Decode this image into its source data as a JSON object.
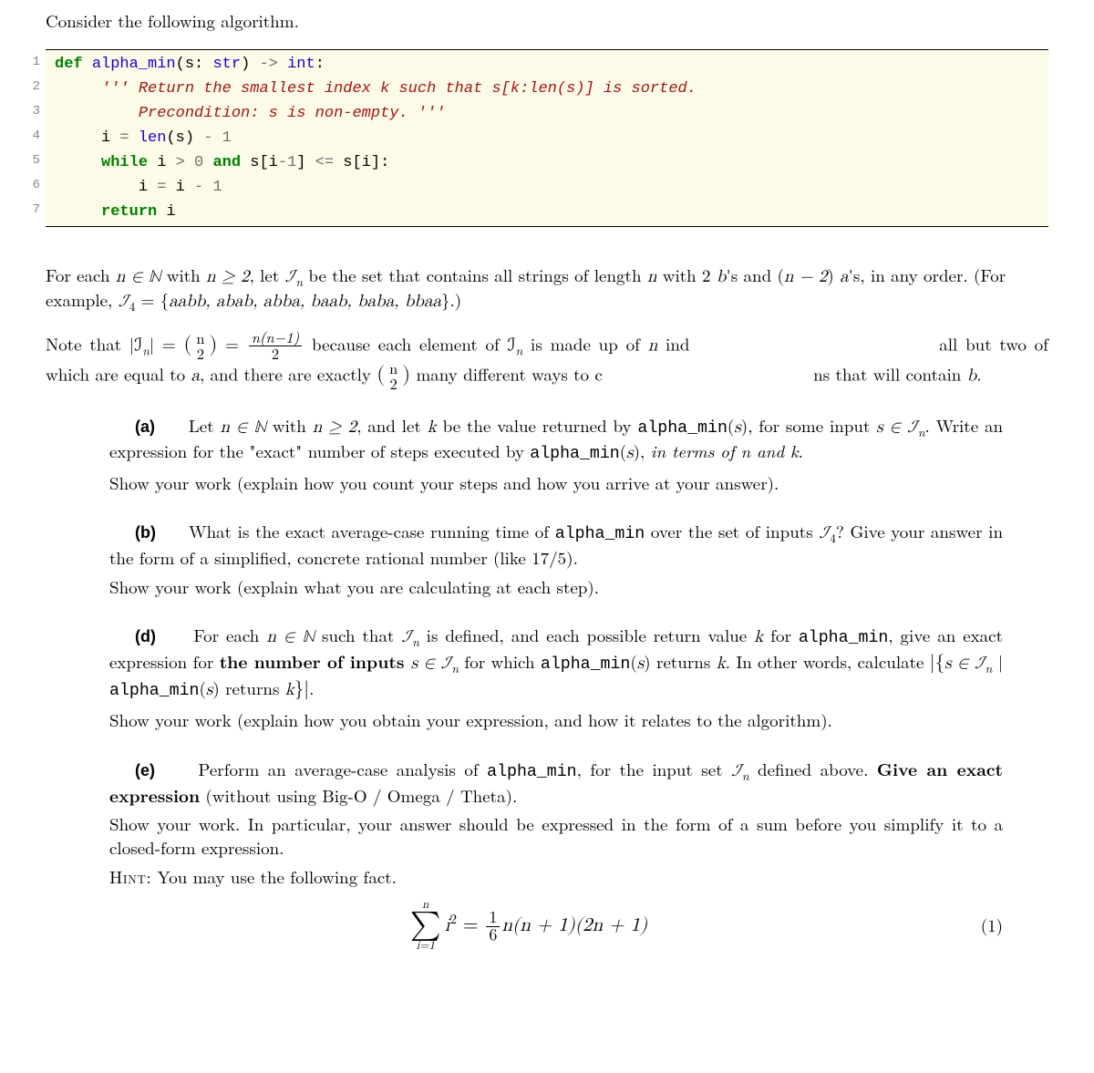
{
  "intro": "Consider the following algorithm.",
  "code": {
    "line_numbers": [
      "1",
      "2",
      "3",
      "4",
      "5",
      "6",
      "7"
    ],
    "l1": {
      "def": "def",
      "fn": "alpha_min",
      "p1": "(s: ",
      "ty1": "str",
      "p2": ")",
      "arr": " -> ",
      "ty2": "int",
      "colon": ":"
    },
    "l2": {
      "tri": "''' Return the smallest index k such that s[k:len(s)] is sorted."
    },
    "l3": {
      "tri": "Precondition: s is non-empty. '''"
    },
    "l4": {
      "a": "i ",
      "eq": "=",
      "sp": " ",
      "len": "len",
      "b": "(s) ",
      "minus": "-",
      "sp2": " ",
      "one": "1"
    },
    "l5": {
      "wh": "while",
      "a": " i ",
      "gt": ">",
      "sp1": " ",
      "zero": "0",
      "sp2": " ",
      "and": "and",
      "b": " s[i",
      "minus": "-",
      "one": "1",
      "c": "] ",
      "le": "<=",
      "d": " s[i]:"
    },
    "l6": {
      "a": "i ",
      "eq": "=",
      "b": " i ",
      "minus": "-",
      "sp": " ",
      "one": "1"
    },
    "l7": {
      "ret": "return",
      "i": " i"
    }
  },
  "after": {
    "p1a": "For each ",
    "p1b": "n ∈ ℕ",
    "p1c": " with ",
    "p1d": "n ≥ 2",
    "p1e": ", let ",
    "p1f": "ℐ",
    "p1g": " be the set that contains all strings of length ",
    "p1h": "n",
    "p1i": " with 2 ",
    "p1j": "b",
    "p1k": "'s and (",
    "p1l": "n − 2",
    "p1m": ") ",
    "p1n": "a",
    "p1o": "'s, in any order. (For example, ",
    "p1p": "ℐ",
    "p1q": " = {",
    "p1r": "aabb, abab, abba, baab, baba, bbaa",
    "p1s": "}.)",
    "p2a": "Note that |ℐ",
    "p2b": "| = ",
    "binom_top": "n",
    "binom_bot": "2",
    "p2c": " = ",
    "frac_num": "n(n−1)",
    "frac_den": "2",
    "p2d": " because each element of ℐ",
    "p2e": " is made up of ",
    "p2f": "n",
    "p2g": " ind",
    "p2h": "all but two of which are equal to ",
    "p2i": "a",
    "p2j": ", and there are exactly ",
    "p2k": " many different ways to c",
    "p2l": "ns that will contain ",
    "p2m": "b",
    "p2n": "."
  },
  "q": {
    "a": {
      "label": "(a)",
      "t1": "Let ",
      "t2": "n ∈ ℕ",
      "t3": " with ",
      "t4": "n ≥ 2",
      "t5": ", and let ",
      "t6": "k",
      "t7": " be the value returned by ",
      "t8": "alpha_min",
      "t9": "(",
      "t10": "s",
      "t11": "), for some input ",
      "t12": "s ∈ ℐ",
      "t13": ". Write an expression for the \"exact\" number of steps executed by ",
      "t14": "alpha_min",
      "t15": "(",
      "t16": "s",
      "t17": "), ",
      "t18": "in terms of n and k",
      "t19": ".",
      "show": "Show your work (explain how you count your steps and how you arrive at your answer)."
    },
    "b": {
      "label": "(b)",
      "t1": "What is the exact average-case running time of ",
      "t2": "alpha_min",
      "t3": " over the set of inputs ",
      "t4": "ℐ",
      "t5": "? Give your answer in the form of a simplified, concrete rational number (like 17/5).",
      "show": "Show your work (explain what you are calculating at each step)."
    },
    "d": {
      "label": "(d)",
      "t1": "For each ",
      "t2": "n ∈ ℕ",
      "t3": " such that ",
      "t4": "ℐ",
      "t5": " is defined, and each possible return value ",
      "t6": "k",
      "t7": " for ",
      "t8": "alpha_min",
      "t9": ", give an exact expression for ",
      "t10": "the number of inputs ",
      "t11": "s ∈ ℐ",
      "t12": " for which ",
      "t13": "alpha_min",
      "t14": "(",
      "t15": "s",
      "t16": ") returns ",
      "t17": "k",
      "t18": ". In other words, calculate ",
      "set1": "|{",
      "set2": "s ∈ ℐ",
      "set3": " | ",
      "set4": "alpha_min",
      "set5": "(",
      "set6": "s",
      "set7": ") returns ",
      "set8": "k",
      "set9": "}|",
      "t19": ".",
      "show": "Show your work (explain how you obtain your expression, and how it relates to the algorithm)."
    },
    "e": {
      "label": "(e)",
      "t1": "Perform an average-case analysis of ",
      "t2": "alpha_min",
      "t3": ", for the input set ",
      "t4": "ℐ",
      "t5": " defined above. ",
      "t6": "Give an exact expression",
      "t7": " (without using Big-O / Omega / Theta).",
      "show": "Show your work. In particular, your answer should be expressed in the form of a sum before you simplify it to a closed-form expression.",
      "hint_l": "Hint:",
      "hint": " You may use the following fact."
    }
  },
  "eq": {
    "upper": "n",
    "sigma": "∑",
    "lower": "i=1",
    "lhs": "i",
    "lhs_sup": "2",
    "eq": " = ",
    "frac_num": "1",
    "frac_den": "6",
    "rhs": "n(n + 1)(2n + 1)",
    "num": "(1)"
  }
}
